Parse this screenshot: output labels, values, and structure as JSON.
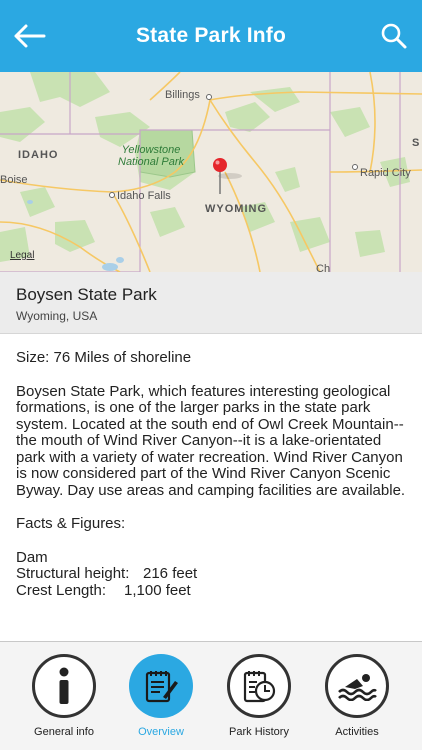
{
  "header": {
    "title": "State Park Info",
    "back_icon": "back-arrow-icon",
    "search_icon": "search-icon",
    "color": "#2ba8e2"
  },
  "map": {
    "labels": {
      "billings": "Billings",
      "idaho": "IDAHO",
      "yellowstone_line1": "Yellowstone",
      "yellowstone_line2": "National Park",
      "boise": "Boise",
      "idaho_falls": "Idaho Falls",
      "wyoming": "WYOMING",
      "rapid_city": "Rapid City",
      "sd_partial": "S",
      "ch_partial": "Ch"
    },
    "legal": "Legal",
    "pin_icon": "map-pin-icon"
  },
  "park": {
    "name": "Boysen State Park",
    "location": "Wyoming, USA"
  },
  "content": {
    "size": "Size: 76 Miles of shoreline",
    "description": "Boysen State Park, which features interesting geological formations, is one of the larger parks in the state park system. Located at the south end of Owl Creek Mountain--the mouth of Wind River Canyon--it is a lake-orientated park with a variety of water recreation. Wind River Canyon is now considered part of the Wind River Canyon Scenic Byway. Day use areas and camping facilities are available.",
    "facts_heading": "Facts & Figures:",
    "dam_label": "Dam",
    "structural_height_label": "Structural height:",
    "structural_height_value": "216 feet",
    "crest_length_label": "Crest Length:",
    "crest_length_value": "1,100 feet"
  },
  "tabs": [
    {
      "label": "General info",
      "icon": "info-icon",
      "active": false
    },
    {
      "label": "Overview",
      "icon": "notepad-pencil-icon",
      "active": true
    },
    {
      "label": "Park History",
      "icon": "history-clock-icon",
      "active": false
    },
    {
      "label": "Activities",
      "icon": "swimmer-icon",
      "active": false
    }
  ]
}
